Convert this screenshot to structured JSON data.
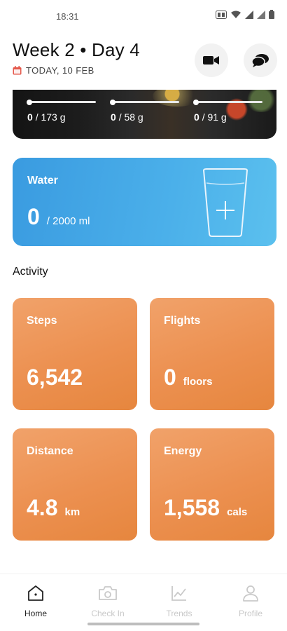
{
  "status_bar": {
    "time": "18:31"
  },
  "header": {
    "title": "Week 2 • Day 4",
    "date": "TODAY, 10 FEB"
  },
  "macros": [
    {
      "value": "0",
      "goal": "/ 173 g"
    },
    {
      "value": "0",
      "goal": "/ 58 g"
    },
    {
      "value": "0",
      "goal": "/ 91 g"
    }
  ],
  "water": {
    "title": "Water",
    "value": "0",
    "goal": "/ 2000 ml"
  },
  "activity": {
    "title": "Activity",
    "tiles": [
      {
        "label": "Steps",
        "value": "6,542",
        "unit": ""
      },
      {
        "label": "Flights",
        "value": "0",
        "unit": "floors"
      },
      {
        "label": "Distance",
        "value": "4.8",
        "unit": "km"
      },
      {
        "label": "Energy",
        "value": "1,558",
        "unit": "cals"
      }
    ]
  },
  "nav": {
    "items": [
      {
        "label": "Home",
        "icon": "home-icon",
        "active": true
      },
      {
        "label": "Check In",
        "icon": "camera-icon",
        "active": false
      },
      {
        "label": "Trends",
        "icon": "trends-icon",
        "active": false
      },
      {
        "label": "Profile",
        "icon": "profile-icon",
        "active": false
      }
    ]
  },
  "colors": {
    "water_card": "#43a8e8",
    "activity_tile": "#ec9050",
    "active_nav": "#222222",
    "inactive_nav": "#c9c9c9",
    "calendar_icon": "#e4574a"
  }
}
